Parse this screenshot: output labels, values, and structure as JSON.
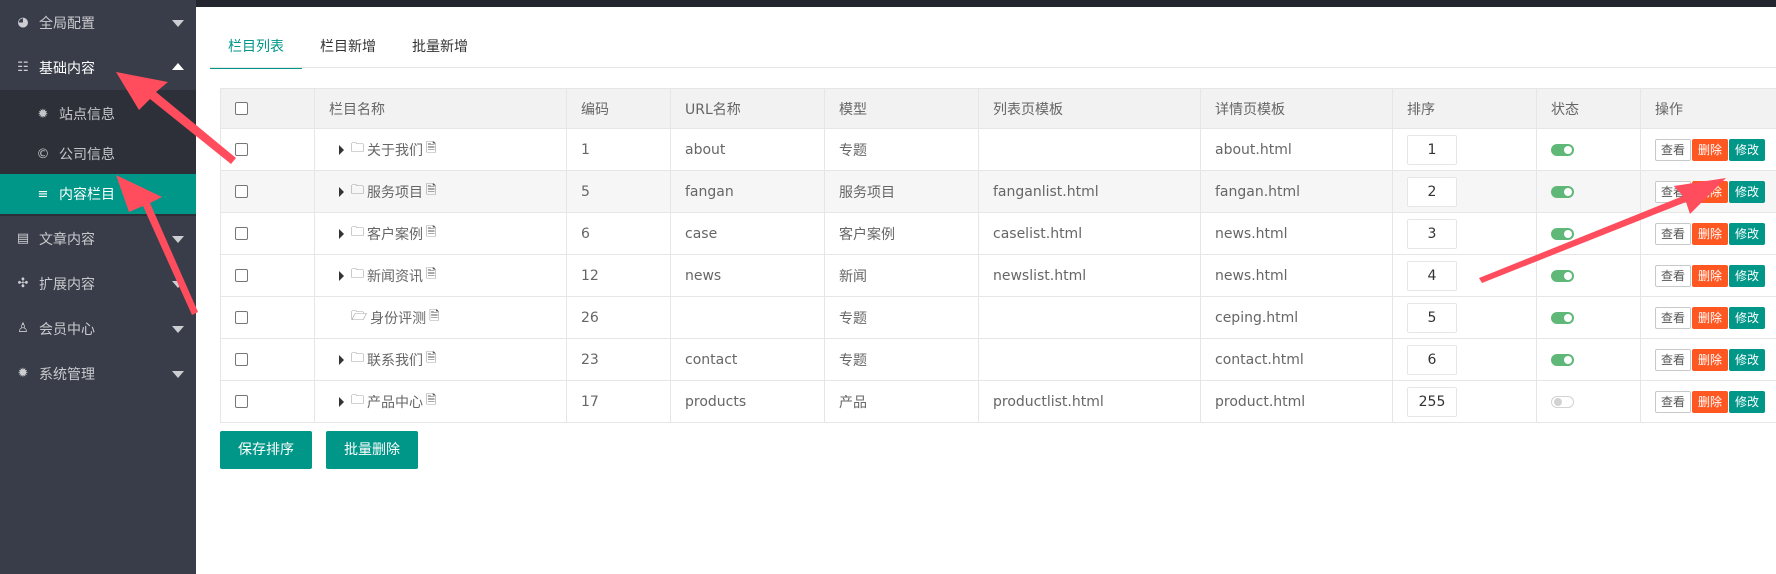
{
  "sidebar": {
    "items": [
      {
        "label": "全局配置",
        "icon": "globe-icon"
      },
      {
        "label": "基础内容",
        "icon": "sliders-icon"
      },
      {
        "label": "文章内容",
        "icon": "document-icon"
      },
      {
        "label": "扩展内容",
        "icon": "expand-icon"
      },
      {
        "label": "会员中心",
        "icon": "user-icon"
      },
      {
        "label": "系统管理",
        "icon": "gear-icon"
      }
    ],
    "sub_items": [
      {
        "label": "站点信息",
        "icon": "gear-icon"
      },
      {
        "label": "公司信息",
        "icon": "copyright-icon"
      },
      {
        "label": "内容栏目",
        "icon": "list-icon"
      }
    ]
  },
  "tabs": [
    "栏目列表",
    "栏目新增",
    "批量新增"
  ],
  "table": {
    "headers": [
      "栏目名称",
      "编码",
      "URL名称",
      "模型",
      "列表页模板",
      "详情页模板",
      "排序",
      "状态",
      "操作"
    ],
    "rows": [
      {
        "name": "关于我们",
        "code": "1",
        "url": "about",
        "model": "专题",
        "list_tpl": "",
        "detail_tpl": "about.html",
        "sort": "1",
        "status": true
      },
      {
        "name": "服务项目",
        "code": "5",
        "url": "fangan",
        "model": "服务项目",
        "list_tpl": "fanganlist.html",
        "detail_tpl": "fangan.html",
        "sort": "2",
        "status": true
      },
      {
        "name": "客户案例",
        "code": "6",
        "url": "case",
        "model": "客户案例",
        "list_tpl": "caselist.html",
        "detail_tpl": "news.html",
        "sort": "3",
        "status": true
      },
      {
        "name": "新闻资讯",
        "code": "12",
        "url": "news",
        "model": "新闻",
        "list_tpl": "newslist.html",
        "detail_tpl": "news.html",
        "sort": "4",
        "status": true
      },
      {
        "name": "身份评测",
        "code": "26",
        "url": "",
        "model": "专题",
        "list_tpl": "",
        "detail_tpl": "ceping.html",
        "sort": "5",
        "status": true
      },
      {
        "name": "联系我们",
        "code": "23",
        "url": "contact",
        "model": "专题",
        "list_tpl": "",
        "detail_tpl": "contact.html",
        "sort": "6",
        "status": true
      },
      {
        "name": "产品中心",
        "code": "17",
        "url": "products",
        "model": "产品",
        "list_tpl": "productlist.html",
        "detail_tpl": "product.html",
        "sort": "255",
        "status": false
      }
    ],
    "actions": {
      "view": "查看",
      "delete": "删除",
      "edit": "修改"
    }
  },
  "buttons": {
    "save_sort": "保存排序",
    "batch_delete": "批量删除"
  },
  "colors": {
    "accent": "#009688",
    "danger": "#ff5722",
    "sidebar": "#393d49",
    "switch_on": "#5fb878",
    "annotation": "#ff4d5e"
  }
}
